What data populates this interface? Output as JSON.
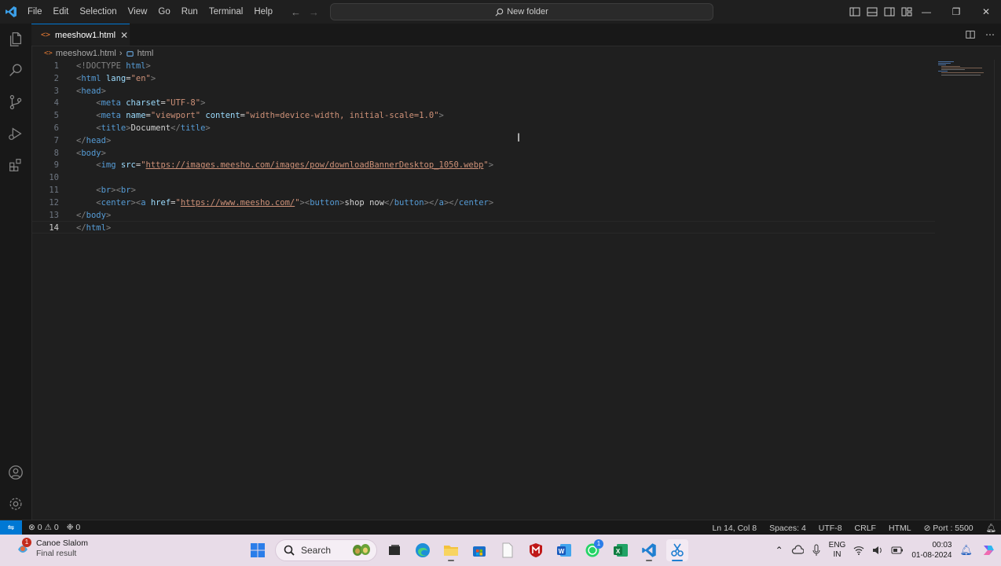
{
  "titlebar": {
    "menu": [
      "File",
      "Edit",
      "Selection",
      "View",
      "Go",
      "Run",
      "Terminal",
      "Help"
    ],
    "search_text": "New folder",
    "window_controls": [
      "minimize-icon",
      "restore-icon",
      "close-icon"
    ]
  },
  "activity_bar": {
    "top_icons": [
      "files-icon",
      "search-icon",
      "source-control-icon",
      "run-debug-icon",
      "extensions-icon"
    ],
    "bottom_icons": [
      "account-icon",
      "gear-icon"
    ]
  },
  "tabs": [
    {
      "label": "meeshow1.html",
      "active": true
    }
  ],
  "breadcrumb": {
    "file": "meeshow1.html",
    "symbol": "html"
  },
  "editor": {
    "current_line": 14,
    "lines": [
      {
        "n": "1",
        "tokens": [
          {
            "t": "<!DOCTYPE ",
            "c": "br"
          },
          {
            "t": "html",
            "c": "tag"
          },
          {
            "t": ">",
            "c": "br"
          }
        ]
      },
      {
        "n": "2",
        "tokens": [
          {
            "t": "<",
            "c": "br"
          },
          {
            "t": "html",
            "c": "tag"
          },
          {
            "t": " ",
            "c": "text"
          },
          {
            "t": "lang",
            "c": "attr"
          },
          {
            "t": "=",
            "c": "text"
          },
          {
            "t": "\"en\"",
            "c": "str"
          },
          {
            "t": ">",
            "c": "br"
          }
        ]
      },
      {
        "n": "3",
        "tokens": [
          {
            "t": "<",
            "c": "br"
          },
          {
            "t": "head",
            "c": "tag"
          },
          {
            "t": ">",
            "c": "br"
          }
        ]
      },
      {
        "n": "4",
        "tokens": [
          {
            "t": "    <",
            "c": "br"
          },
          {
            "t": "meta",
            "c": "tag"
          },
          {
            "t": " ",
            "c": "text"
          },
          {
            "t": "charset",
            "c": "attr"
          },
          {
            "t": "=",
            "c": "text"
          },
          {
            "t": "\"UTF-8\"",
            "c": "str"
          },
          {
            "t": ">",
            "c": "br"
          }
        ]
      },
      {
        "n": "5",
        "tokens": [
          {
            "t": "    <",
            "c": "br"
          },
          {
            "t": "meta",
            "c": "tag"
          },
          {
            "t": " ",
            "c": "text"
          },
          {
            "t": "name",
            "c": "attr"
          },
          {
            "t": "=",
            "c": "text"
          },
          {
            "t": "\"viewport\"",
            "c": "str"
          },
          {
            "t": " ",
            "c": "text"
          },
          {
            "t": "content",
            "c": "attr"
          },
          {
            "t": "=",
            "c": "text"
          },
          {
            "t": "\"width=device-width, initial-scale=1.0\"",
            "c": "str"
          },
          {
            "t": ">",
            "c": "br"
          }
        ]
      },
      {
        "n": "6",
        "tokens": [
          {
            "t": "    <",
            "c": "br"
          },
          {
            "t": "title",
            "c": "tag"
          },
          {
            "t": ">",
            "c": "br"
          },
          {
            "t": "Document",
            "c": "text"
          },
          {
            "t": "</",
            "c": "br"
          },
          {
            "t": "title",
            "c": "tag"
          },
          {
            "t": ">",
            "c": "br"
          }
        ]
      },
      {
        "n": "7",
        "tokens": [
          {
            "t": "</",
            "c": "br"
          },
          {
            "t": "head",
            "c": "tag"
          },
          {
            "t": ">",
            "c": "br"
          }
        ]
      },
      {
        "n": "8",
        "tokens": [
          {
            "t": "<",
            "c": "br"
          },
          {
            "t": "body",
            "c": "tag"
          },
          {
            "t": ">",
            "c": "br"
          }
        ]
      },
      {
        "n": "9",
        "tokens": [
          {
            "t": "    <",
            "c": "br"
          },
          {
            "t": "img",
            "c": "tag"
          },
          {
            "t": " ",
            "c": "text"
          },
          {
            "t": "src",
            "c": "attr"
          },
          {
            "t": "=",
            "c": "text"
          },
          {
            "t": "\"",
            "c": "str"
          },
          {
            "t": "https://images.meesho.com/images/pow/downloadBannerDesktop_1050.webp",
            "c": "str url"
          },
          {
            "t": "\"",
            "c": "str"
          },
          {
            "t": ">",
            "c": "br"
          }
        ]
      },
      {
        "n": "10",
        "tokens": []
      },
      {
        "n": "11",
        "tokens": [
          {
            "t": "    <",
            "c": "br"
          },
          {
            "t": "br",
            "c": "tag"
          },
          {
            "t": "><",
            "c": "br"
          },
          {
            "t": "br",
            "c": "tag"
          },
          {
            "t": ">",
            "c": "br"
          }
        ]
      },
      {
        "n": "12",
        "tokens": [
          {
            "t": "    <",
            "c": "br"
          },
          {
            "t": "center",
            "c": "tag"
          },
          {
            "t": "><",
            "c": "br"
          },
          {
            "t": "a",
            "c": "tag"
          },
          {
            "t": " ",
            "c": "text"
          },
          {
            "t": "href",
            "c": "attr"
          },
          {
            "t": "=",
            "c": "text"
          },
          {
            "t": "\"",
            "c": "str"
          },
          {
            "t": "https://www.meesho.com/",
            "c": "str url"
          },
          {
            "t": "\"",
            "c": "str"
          },
          {
            "t": "><",
            "c": "br"
          },
          {
            "t": "button",
            "c": "tag"
          },
          {
            "t": ">",
            "c": "br"
          },
          {
            "t": "shop now",
            "c": "text"
          },
          {
            "t": "</",
            "c": "br"
          },
          {
            "t": "button",
            "c": "tag"
          },
          {
            "t": "></",
            "c": "br"
          },
          {
            "t": "a",
            "c": "tag"
          },
          {
            "t": "></",
            "c": "br"
          },
          {
            "t": "center",
            "c": "tag"
          },
          {
            "t": ">",
            "c": "br"
          }
        ]
      },
      {
        "n": "13",
        "tokens": [
          {
            "t": "</",
            "c": "br"
          },
          {
            "t": "body",
            "c": "tag"
          },
          {
            "t": ">",
            "c": "br"
          }
        ]
      },
      {
        "n": "14",
        "tokens": [
          {
            "t": "</",
            "c": "br"
          },
          {
            "t": "html",
            "c": "tag"
          },
          {
            "t": ">",
            "c": "br"
          }
        ]
      }
    ]
  },
  "statusbar": {
    "errors": "0",
    "warnings": "0",
    "ports": "0",
    "position": "Ln 14, Col 8",
    "spaces": "Spaces: 4",
    "encoding": "UTF-8",
    "eol": "CRLF",
    "language": "HTML",
    "port": "Port : 5500"
  },
  "taskbar": {
    "weather_title": "Canoe Slalom",
    "weather_subtitle": "Final result",
    "weather_badge": "1",
    "search_placeholder": "Search",
    "whatsapp_badge": "1",
    "lang_top": "ENG",
    "lang_bottom": "IN",
    "time": "00:03",
    "date": "01-08-2024"
  },
  "colors": {
    "accent": "#0078d4",
    "editor_bg": "#1f1f1f",
    "tag": "#569cd6",
    "attr": "#9cdcfe",
    "string": "#ce9178"
  }
}
